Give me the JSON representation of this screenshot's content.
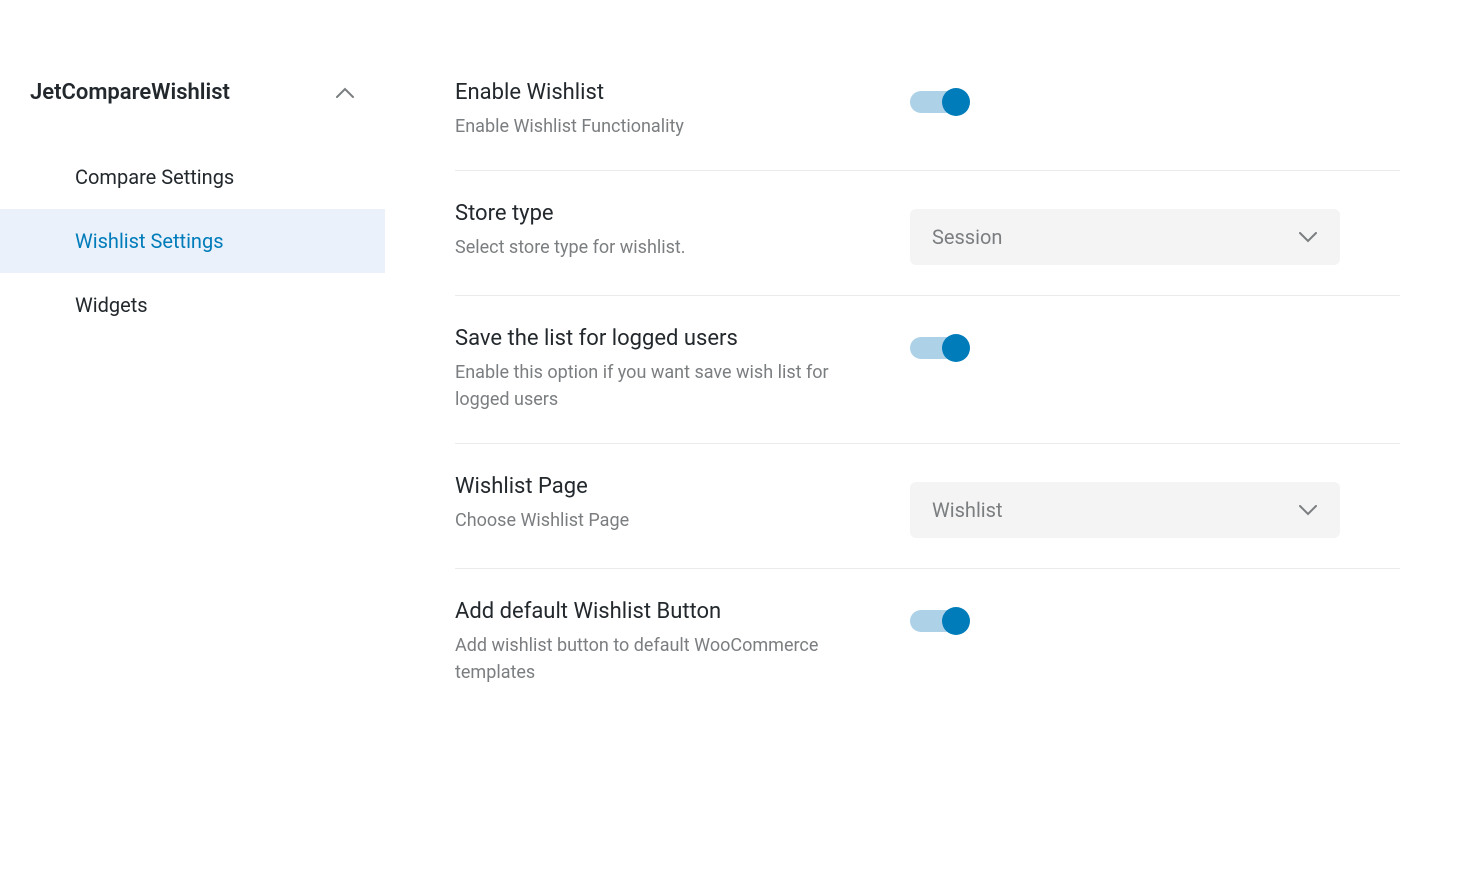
{
  "sidebar": {
    "title": "JetCompareWishlist",
    "items": [
      {
        "label": "Compare Settings",
        "active": false
      },
      {
        "label": "Wishlist Settings",
        "active": true
      },
      {
        "label": "Widgets",
        "active": false
      }
    ]
  },
  "settings": [
    {
      "title": "Enable Wishlist",
      "desc": "Enable Wishlist Functionality",
      "type": "toggle",
      "value": true
    },
    {
      "title": "Store type",
      "desc": "Select store type for wishlist.",
      "type": "select",
      "value": "Session"
    },
    {
      "title": "Save the list for logged users",
      "desc": "Enable this option if you want save wish list for logged users",
      "type": "toggle",
      "value": true
    },
    {
      "title": "Wishlist Page",
      "desc": "Choose Wishlist Page",
      "type": "select",
      "value": "Wishlist"
    },
    {
      "title": "Add default Wishlist Button",
      "desc": "Add wishlist button to default WooCommerce templates",
      "type": "toggle",
      "value": true
    }
  ]
}
